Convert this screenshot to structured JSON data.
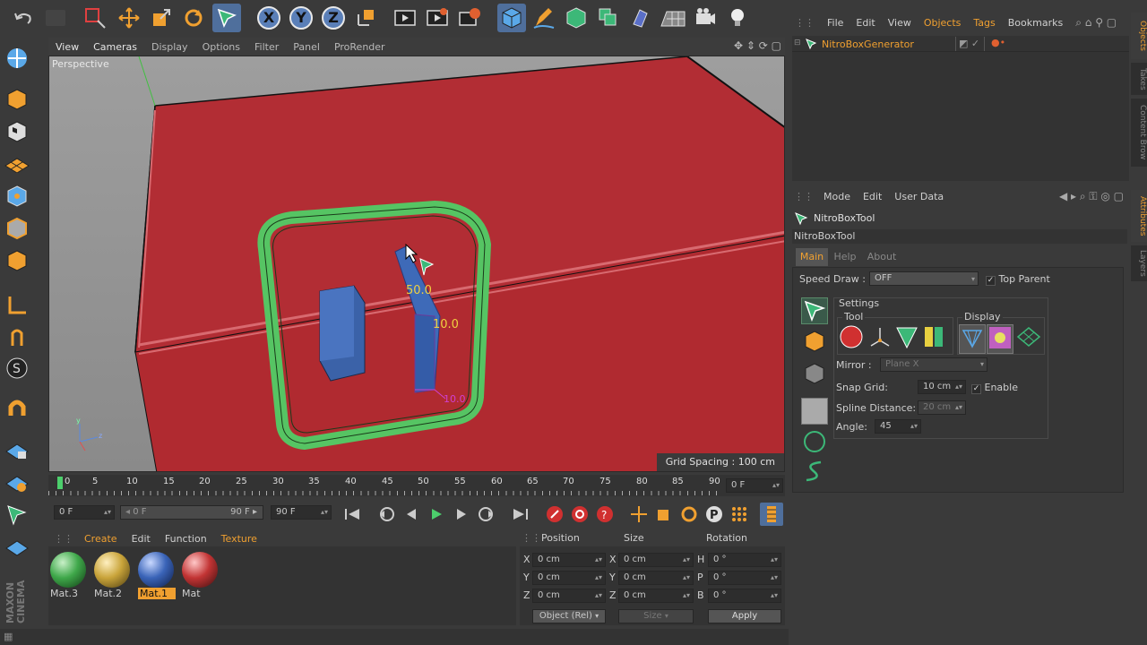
{
  "viewport": {
    "menu": [
      "View",
      "Cameras",
      "Display",
      "Options",
      "Filter",
      "Panel",
      "ProRender"
    ],
    "label": "Perspective",
    "grid_spacing": "Grid Spacing : 100 cm",
    "dim_a": "50.0",
    "dim_b": "10.0",
    "dim_c": "10.0"
  },
  "timeline": {
    "ticks": [
      "0",
      "5",
      "10",
      "15",
      "20",
      "25",
      "30",
      "35",
      "40",
      "45",
      "50",
      "55",
      "60",
      "65",
      "70",
      "75",
      "80",
      "85",
      "90"
    ],
    "current": "0 F",
    "start": "0 F",
    "range_start": "0 F",
    "range_end": "90 F",
    "end": "90 F"
  },
  "materials": {
    "menu": [
      "Create",
      "Edit",
      "Function",
      "Texture"
    ],
    "items": [
      {
        "name": "Mat.3",
        "color": "#3fa84a"
      },
      {
        "name": "Mat.2",
        "color": "#c9a43a"
      },
      {
        "name": "Mat.1",
        "color": "#3a64b8"
      },
      {
        "name": "Mat",
        "color": "#c23434"
      }
    ]
  },
  "coords": {
    "headers": [
      "Position",
      "Size",
      "Rotation"
    ],
    "rows": [
      {
        "p": "X",
        "pv": "0 cm",
        "s": "X",
        "sv": "0 cm",
        "r": "H",
        "rv": "0 °"
      },
      {
        "p": "Y",
        "pv": "0 cm",
        "s": "Y",
        "sv": "0 cm",
        "r": "P",
        "rv": "0 °"
      },
      {
        "p": "Z",
        "pv": "0 cm",
        "s": "Z",
        "sv": "0 cm",
        "r": "B",
        "rv": "0 °"
      }
    ],
    "mode": "Object (Rel)",
    "size_mode": "Size",
    "apply": "Apply"
  },
  "object_manager": {
    "menu": [
      "File",
      "Edit",
      "View",
      "Objects",
      "Tags",
      "Bookmarks"
    ],
    "object": "NitroBoxGenerator"
  },
  "attributes": {
    "menu": [
      "Mode",
      "Edit",
      "User Data"
    ],
    "tool_title": "NitroBoxTool",
    "tool_subtitle": "NitroBoxTool",
    "tabs": [
      "Main",
      "Help",
      "About"
    ],
    "speed_draw_label": "Speed Draw :",
    "speed_draw_value": "OFF",
    "top_parent": "Top Parent",
    "settings": "Settings",
    "tool_group": "Tool",
    "display_group": "Display",
    "mirror_label": "Mirror :",
    "mirror_value": "Plane X",
    "snap_label": "Snap Grid:",
    "snap_value": "10 cm",
    "enable": "Enable",
    "spline_label": "Spline Distance:",
    "spline_value": "20 cm",
    "angle_label": "Angle:",
    "angle_value": "45"
  },
  "side_tabs": [
    "Objects",
    "Takes",
    "Content Brow",
    "Attributes",
    "Layers"
  ],
  "brand": "MAXON CINEMA"
}
